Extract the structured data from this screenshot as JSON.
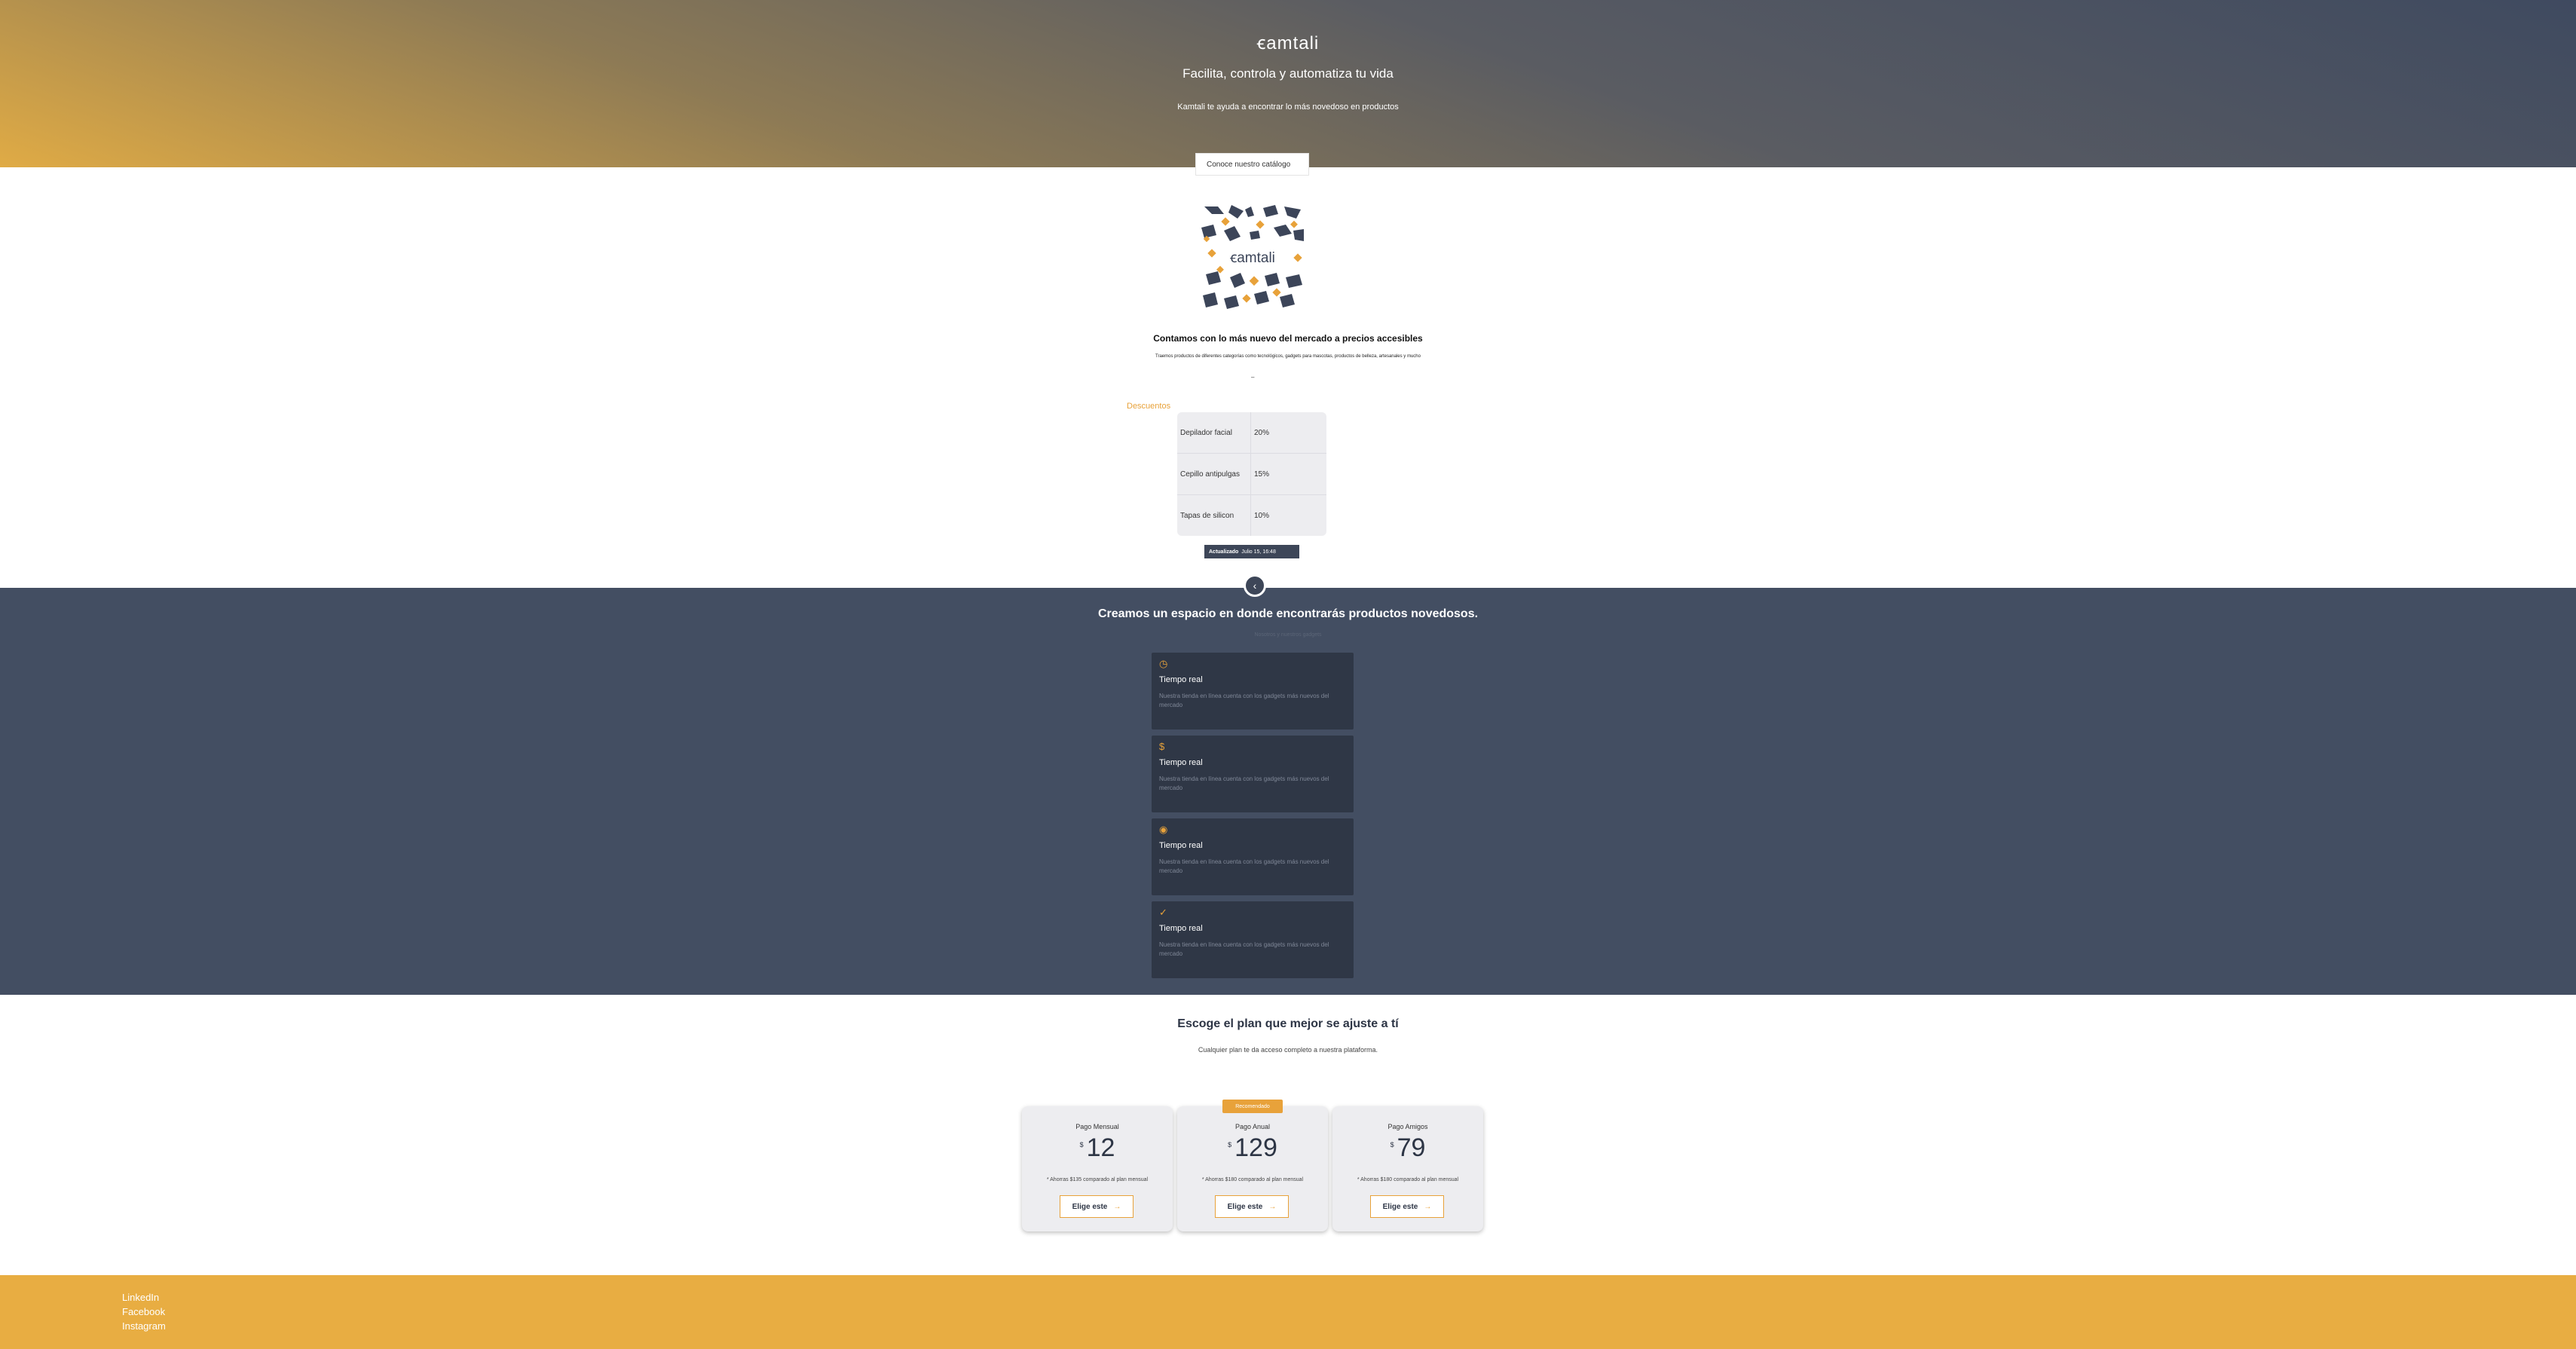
{
  "hero": {
    "brand": "ꞓamtali",
    "title": "Facilita, controla y automatiza tu vida",
    "subtitle": "Kamtali te ayuda a encontrar lo más novedoso en productos",
    "catalog_button": "Conoce nuestro catálogo"
  },
  "logo_tile": {
    "text": "ꞓamtali"
  },
  "intro": {
    "title": "Contamos con lo más nuevo del mercado a precios accesibles",
    "description": "Traemos productos de diferentes categorías como tecnológicos, gadgets para mascotas, productos de belleza, artesanales y mucho",
    "dash": "–"
  },
  "discounts": {
    "label": "Descuentos",
    "rows": [
      {
        "name": "Depilador facial",
        "value": "20%"
      },
      {
        "name": "Cepillo antipulgas",
        "value": "15%"
      },
      {
        "name": "Tapas de silicon",
        "value": "10%"
      }
    ],
    "updated_label": "Actualizado",
    "updated_value": "Julio 15, 16:48"
  },
  "nav": {
    "prev_glyph": "‹"
  },
  "features": {
    "title": "Creamos un espacio en donde encontrarás productos novedosos.",
    "subtitle": "Nosotros y nuestros gadgets",
    "cards": [
      {
        "icon": "clock-icon",
        "glyph": "◷",
        "title": "Tiempo real",
        "desc": "Nuestra tienda en línea cuenta con los gadgets más nuevos del mercado"
      },
      {
        "icon": "dollar-icon",
        "glyph": "$",
        "title": "Tiempo real",
        "desc": "Nuestra tienda en línea cuenta con los gadgets más nuevos del mercado"
      },
      {
        "icon": "eye-icon",
        "glyph": "◉",
        "title": "Tiempo real",
        "desc": "Nuestra tienda en línea cuenta con los gadgets más nuevos del mercado"
      },
      {
        "icon": "check-circle-icon",
        "glyph": "✓",
        "title": "Tiempo real",
        "desc": "Nuestra tienda en línea cuenta con los gadgets más nuevos del mercado"
      }
    ]
  },
  "pricing": {
    "title": "Escoge el plan que mejor se ajuste a tí",
    "subtitle": "Cualquier plan te da acceso completo a nuestra plataforma.",
    "badge": "Recomendado",
    "currency": "$",
    "plans": [
      {
        "name": "Pago Mensual",
        "price": "12",
        "note": "* Ahorras $135 comparado al plan mensual",
        "button": "Elige este"
      },
      {
        "name": "Pago Anual",
        "price": "129",
        "note": "* Ahorras $180 comparado al plan mensual",
        "button": "Elige este"
      },
      {
        "name": "Pago Amigos",
        "price": "79",
        "note": "* Ahorras $180 comparado al plan mensual",
        "button": "Elige este"
      }
    ]
  },
  "footer": {
    "links": [
      "LinkedIn",
      "Facebook",
      "Instagram"
    ]
  },
  "colors": {
    "accent": "#e8a23a",
    "dark": "#434e62",
    "card": "#2f3746",
    "footer": "#e8ad42"
  }
}
